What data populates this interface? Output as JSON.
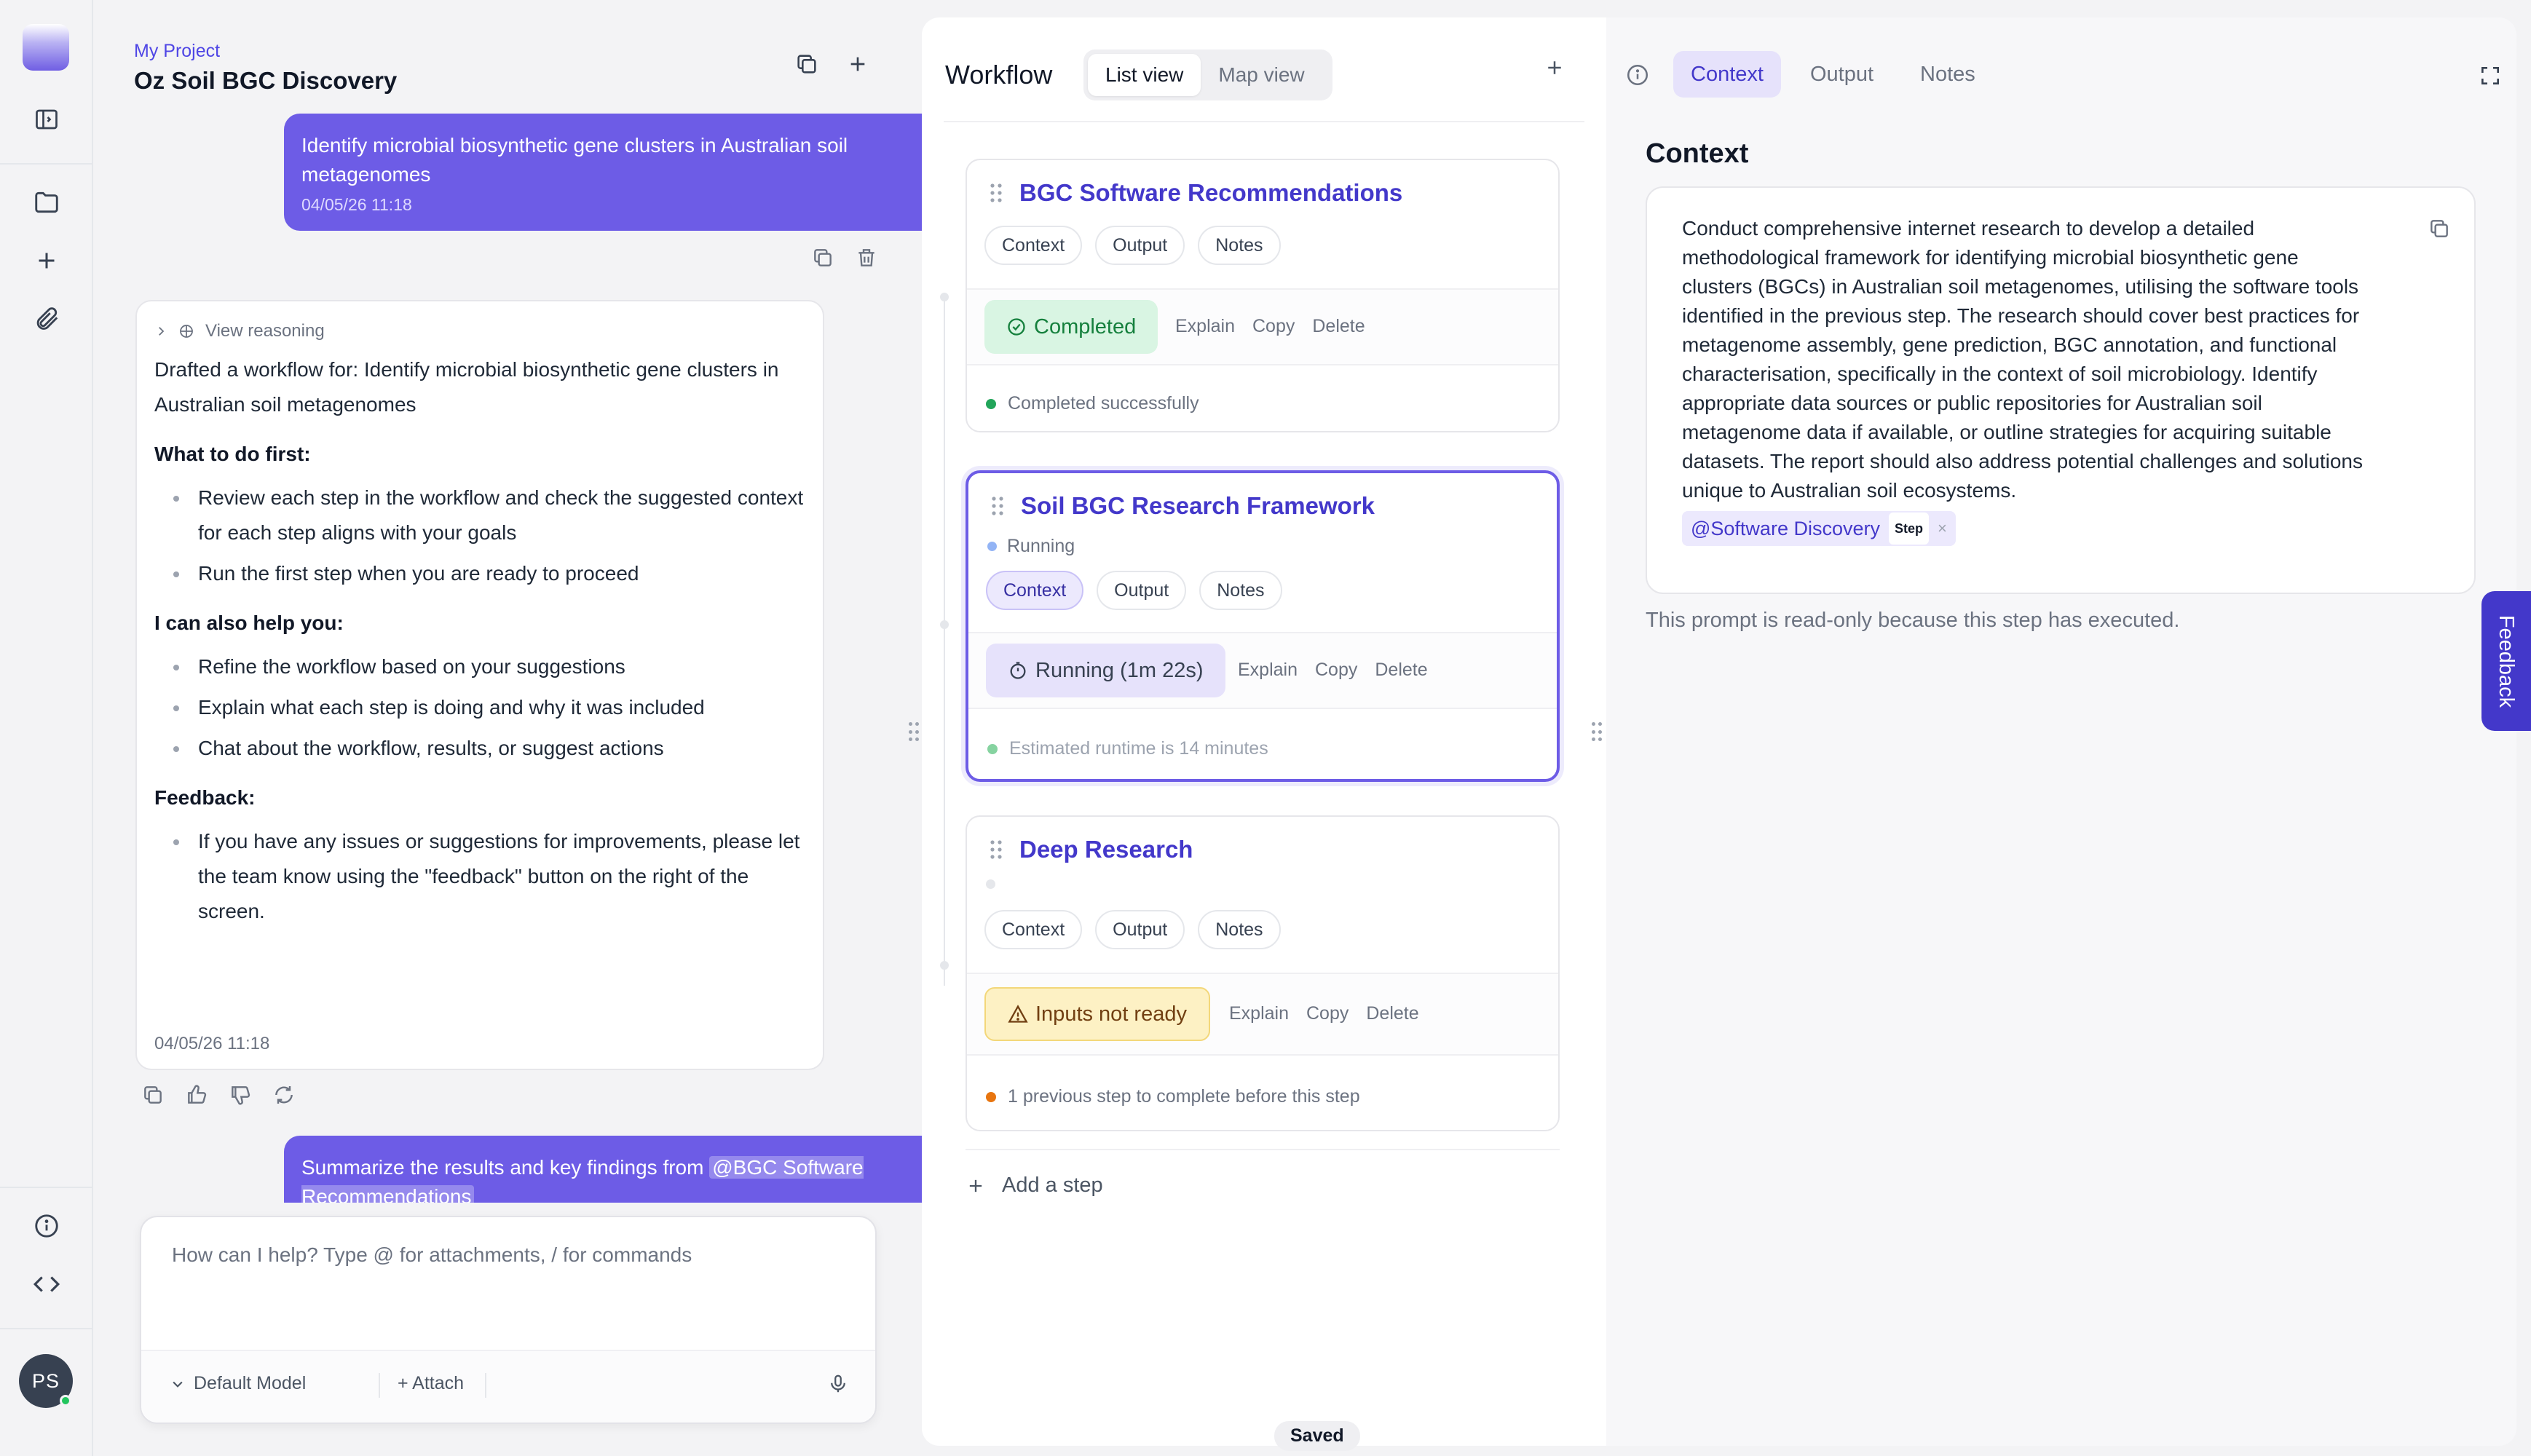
{
  "rail": {
    "icons": [
      "sidebar-toggle-icon",
      "folder-icon",
      "plus-icon",
      "paperclip-icon",
      "info-icon",
      "code-icon"
    ],
    "avatar_initials": "PS"
  },
  "chat": {
    "breadcrumb": "My Project",
    "title": "Oz Soil BGC Discovery",
    "user_message_1": {
      "text": "Identify microbial biosynthetic gene clusters in Australian soil metagenomes",
      "timestamp": "04/05/26 11:18"
    },
    "assistant_message": {
      "reasoning_label": "View reasoning",
      "intro": "Drafted a workflow for: Identify microbial biosynthetic gene clusters in Australian soil metagenomes",
      "section1_title": "What to do first:",
      "section1_items": [
        "Review each step in the workflow and check the suggested context for each step aligns with your goals",
        "Run the first step when you are ready to proceed"
      ],
      "section2_title": "I can also help you:",
      "section2_items": [
        "Refine the workflow based on your suggestions",
        "Explain what each step is doing and why it was included",
        "Chat about the workflow, results, or suggest actions"
      ],
      "section3_title": "Feedback:",
      "section3_items": [
        "If you have any issues or suggestions for improvements, please let the team know using the \"feedback\" button on the right of the screen."
      ],
      "timestamp": "04/05/26 11:18"
    },
    "user_message_2": {
      "text_prefix": "Summarize the results and key findings from ",
      "mention": "@BGC Software Recommendations"
    },
    "composer": {
      "placeholder": "How can I help? Type @ for attachments, / for commands",
      "model_label": "Default Model",
      "attach_label": "+ Attach"
    }
  },
  "workflow": {
    "title": "Workflow",
    "views": [
      "List view",
      "Map view"
    ],
    "active_view": "List view",
    "chip_labels": [
      "Context",
      "Output",
      "Notes"
    ],
    "action_labels": [
      "Explain",
      "Copy",
      "Delete"
    ],
    "steps": [
      {
        "title": "BGC Software Recommendations",
        "status_label": "Completed",
        "footer": "Completed successfully",
        "footer_color": "#22a55a"
      },
      {
        "title": "Soil BGC Research Framework",
        "sub_status": "Running",
        "status_label": "Running (1m 22s)",
        "footer": "Estimated runtime is 14 minutes",
        "footer_color": "#86d3a0"
      },
      {
        "title": "Deep Research",
        "status_label": "Inputs not ready",
        "footer": "1 previous step to complete before this step",
        "footer_color": "#e8750f"
      }
    ],
    "add_step_label": "Add a step",
    "saved_label": "Saved"
  },
  "context_panel": {
    "tabs": [
      "Context",
      "Output",
      "Notes"
    ],
    "active_tab": "Context",
    "heading": "Context",
    "prompt_text": "Conduct comprehensive internet research to develop a detailed methodological framework for identifying microbial biosynthetic gene clusters (BGCs) in Australian soil metagenomes, utilising the software tools identified in the previous step. The research should cover best practices for metagenome assembly, gene prediction, BGC annotation, and functional characterisation, specifically in the context of soil microbiology. Identify appropriate data sources or public repositories for Australian soil metagenome data if available, or outline strategies for acquiring suitable datasets. The report should also address potential challenges and solutions unique to Australian soil ecosystems.",
    "mention_label": "@Software Discovery",
    "mention_tag": "Step",
    "mention_remove": "×",
    "readonly_note": "This prompt is read-only because this step has executed."
  },
  "feedback_label": "Feedback",
  "colors": {
    "accent": "#6d5ce6",
    "accent_dark": "#4338ca",
    "completed_bg": "#d9f5e3",
    "running_bg": "#e6e2fb",
    "warning_bg": "#fdf1c4"
  }
}
